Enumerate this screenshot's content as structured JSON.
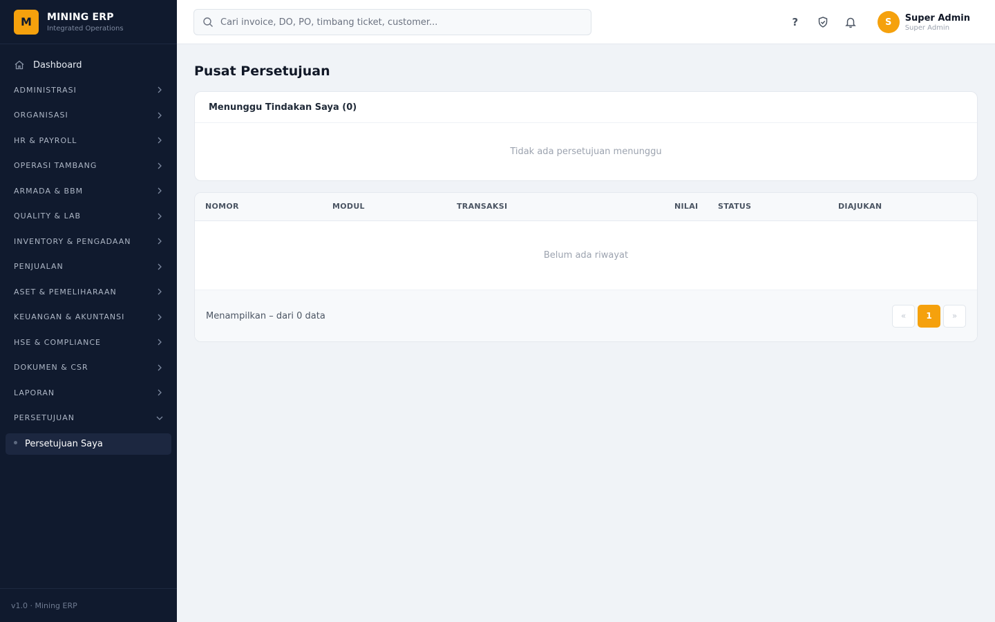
{
  "brand": {
    "logo_letter": "M",
    "name": "MINING ERP",
    "subtitle": "Integrated Operations"
  },
  "sidebar": {
    "dashboard_label": "Dashboard",
    "groups": [
      "ADMINISTRASI",
      "ORGANISASI",
      "HR & PAYROLL",
      "OPERASI TAMBANG",
      "ARMADA & BBM",
      "QUALITY & LAB",
      "INVENTORY & PENGADAAN",
      "PENJUALAN",
      "ASET & PEMELIHARAAN",
      "KEUANGAN & AKUNTANSI",
      "HSE & COMPLIANCE",
      "DOKUMEN & CSR",
      "LAPORAN",
      "PERSETUJUAN"
    ],
    "expanded_group": "PERSETUJUAN",
    "active_subitem": "Persetujuan Saya",
    "footer": "v1.0 · Mining ERP"
  },
  "topbar": {
    "search_placeholder": "Cari invoice, DO, PO, timbang ticket, customer...",
    "help_icon": "?",
    "user": {
      "initial": "S",
      "name": "Super Admin",
      "role": "Super Admin"
    }
  },
  "main": {
    "title": "Pusat Persetujuan",
    "pending_card": {
      "title": "Menunggu Tindakan Saya (0)",
      "empty_text": "Tidak ada persetujuan menunggu"
    },
    "history_table": {
      "columns": [
        "NOMOR",
        "MODUL",
        "TRANSAKSI",
        "NILAI",
        "STATUS",
        "DIAJUKAN"
      ],
      "empty_text": "Belum ada riwayat",
      "footer_text": "Menampilkan – dari 0 data",
      "pagination": {
        "prev": "«",
        "current": "1",
        "next": "»"
      }
    }
  },
  "colors": {
    "accent": "#f5a10d",
    "sidebar_bg": "#101a2e",
    "page_bg": "#f0f3f7"
  }
}
